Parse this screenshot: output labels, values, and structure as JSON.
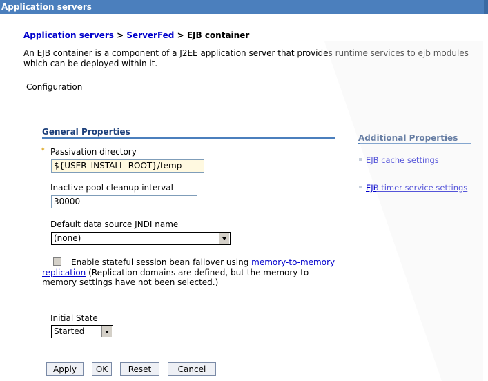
{
  "window": {
    "title": "Application servers"
  },
  "breadcrumb": {
    "item1": "Application servers",
    "sep1": " > ",
    "item2": "ServerFed",
    "sep2": " > ",
    "current": "EJB container"
  },
  "description": "An EJB container is a component of a J2EE application server that provides runtime services to ejb modules which can be deployed within it.",
  "tabs": {
    "configuration": "Configuration"
  },
  "general": {
    "heading": "General Properties",
    "required_marker": "*",
    "passivation": {
      "label": "Passivation directory",
      "value": "${USER_INSTALL_ROOT}/temp"
    },
    "cleanup": {
      "label": "Inactive pool cleanup interval",
      "value": "30000"
    },
    "datasource": {
      "label": "Default data source JNDI name",
      "selected": "(none)"
    },
    "failover": {
      "label_before": "Enable stateful session bean failover using ",
      "link": "memory-to-memory replication",
      "label_after": " (Replication domains are defined, but the memory to memory settings have not been selected.)",
      "checked": false,
      "disabled": true
    },
    "initial_state": {
      "label": "Initial State",
      "selected": "Started"
    }
  },
  "additional": {
    "heading": "Additional Properties",
    "links": [
      "EJB cache settings",
      "EJB timer service settings"
    ]
  },
  "buttons": {
    "apply": "Apply",
    "ok": "OK",
    "reset": "Reset",
    "cancel": "Cancel"
  },
  "colors": {
    "titlebar": "#4b7fbd",
    "link": "#0000cc",
    "section_heading": "#1c3f7a",
    "required": "#d89a00"
  }
}
